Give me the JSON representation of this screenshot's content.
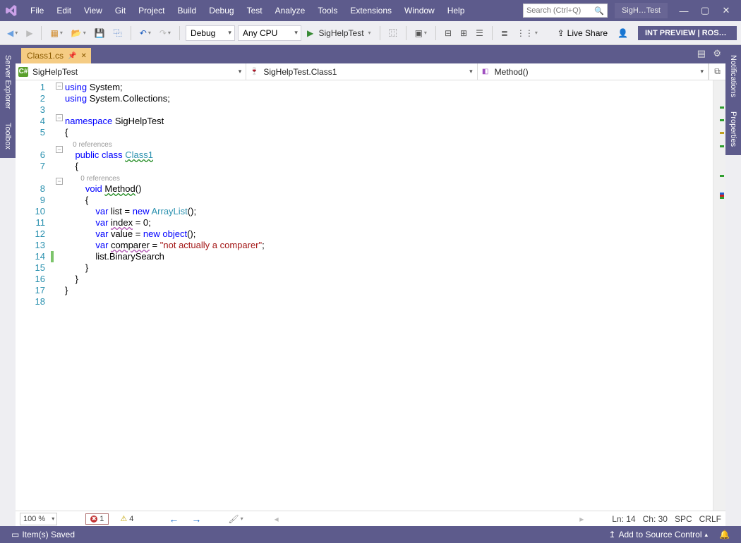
{
  "menu": [
    "File",
    "Edit",
    "View",
    "Git",
    "Project",
    "Build",
    "Debug",
    "Test",
    "Analyze",
    "Tools",
    "Extensions",
    "Window",
    "Help"
  ],
  "search_placeholder": "Search (Ctrl+Q)",
  "solution_badge": "SigH…Test",
  "toolbar": {
    "config": "Debug",
    "platform": "Any CPU",
    "start": "SigHelpTest",
    "liveshare": "Live Share",
    "intpreview": "INT PREVIEW | ROSLY…"
  },
  "side_left": [
    "Server Explorer",
    "Toolbox"
  ],
  "side_right": [
    "Notifications",
    "Properties"
  ],
  "tab": {
    "filename": "Class1.cs"
  },
  "nav": {
    "project": "SigHelpTest",
    "class": "SigHelpTest.Class1",
    "member": "Method()"
  },
  "code": {
    "lines": [
      {
        "n": 1,
        "fold": "-",
        "seg": [
          {
            "t": "using ",
            "c": "kw"
          },
          {
            "t": "System;"
          }
        ]
      },
      {
        "n": 2,
        "seg": [
          {
            "t": "using ",
            "c": "kw"
          },
          {
            "t": "System.Collections;"
          }
        ]
      },
      {
        "n": 3,
        "seg": [
          {
            "t": ""
          }
        ]
      },
      {
        "n": 4,
        "fold": "-",
        "seg": [
          {
            "t": "namespace ",
            "c": "kw"
          },
          {
            "t": "SigHelpTest"
          }
        ]
      },
      {
        "n": 5,
        "seg": [
          {
            "t": "{"
          }
        ]
      },
      {
        "n": 0,
        "codelens": "0 references",
        "indent": "    "
      },
      {
        "n": 6,
        "fold": "-",
        "seg": [
          {
            "t": "    "
          },
          {
            "t": "public class ",
            "c": "kw"
          },
          {
            "t": "Class1",
            "c": "type squig-green"
          }
        ]
      },
      {
        "n": 7,
        "seg": [
          {
            "t": "    {"
          }
        ]
      },
      {
        "n": 0,
        "codelens": "0 references",
        "indent": "        "
      },
      {
        "n": 8,
        "fold": "-",
        "seg": [
          {
            "t": "        "
          },
          {
            "t": "void ",
            "c": "kw"
          },
          {
            "t": "Method",
            "c": "squig-green"
          },
          {
            "t": "()"
          }
        ]
      },
      {
        "n": 9,
        "seg": [
          {
            "t": "        {"
          }
        ]
      },
      {
        "n": 10,
        "seg": [
          {
            "t": "            "
          },
          {
            "t": "var ",
            "c": "kw"
          },
          {
            "t": "list = "
          },
          {
            "t": "new ",
            "c": "kw"
          },
          {
            "t": "ArrayList",
            "c": "type"
          },
          {
            "t": "();"
          }
        ]
      },
      {
        "n": 11,
        "seg": [
          {
            "t": "            "
          },
          {
            "t": "var ",
            "c": "kw"
          },
          {
            "t": "index",
            "c": "squig-purple"
          },
          {
            "t": " = 0;"
          }
        ]
      },
      {
        "n": 12,
        "seg": [
          {
            "t": "            "
          },
          {
            "t": "var ",
            "c": "kw"
          },
          {
            "t": "value = "
          },
          {
            "t": "new ",
            "c": "kw"
          },
          {
            "t": "object",
            "c": "kw"
          },
          {
            "t": "();"
          }
        ]
      },
      {
        "n": 13,
        "seg": [
          {
            "t": "            "
          },
          {
            "t": "var ",
            "c": "kw"
          },
          {
            "t": "comparer",
            "c": "squig-purple"
          },
          {
            "t": " = "
          },
          {
            "t": "\"not actually a comparer\"",
            "c": "str"
          },
          {
            "t": ";"
          }
        ]
      },
      {
        "n": 14,
        "hl": true,
        "seg": [
          {
            "t": "            list.BinarySearch"
          }
        ]
      },
      {
        "n": 15,
        "seg": [
          {
            "t": "        }"
          }
        ]
      },
      {
        "n": 16,
        "seg": [
          {
            "t": "    }"
          }
        ]
      },
      {
        "n": 17,
        "seg": [
          {
            "t": "}"
          }
        ]
      },
      {
        "n": 18,
        "seg": [
          {
            "t": ""
          }
        ]
      }
    ],
    "changebar_line": 14
  },
  "editor_status": {
    "zoom": "100 %",
    "errors": "1",
    "warnings": "4",
    "ln": "Ln: 14",
    "ch": "Ch: 30",
    "ws": "SPC",
    "eol": "CRLF"
  },
  "statusbar": {
    "left": "Item(s) Saved",
    "src": "Add to Source Control"
  }
}
